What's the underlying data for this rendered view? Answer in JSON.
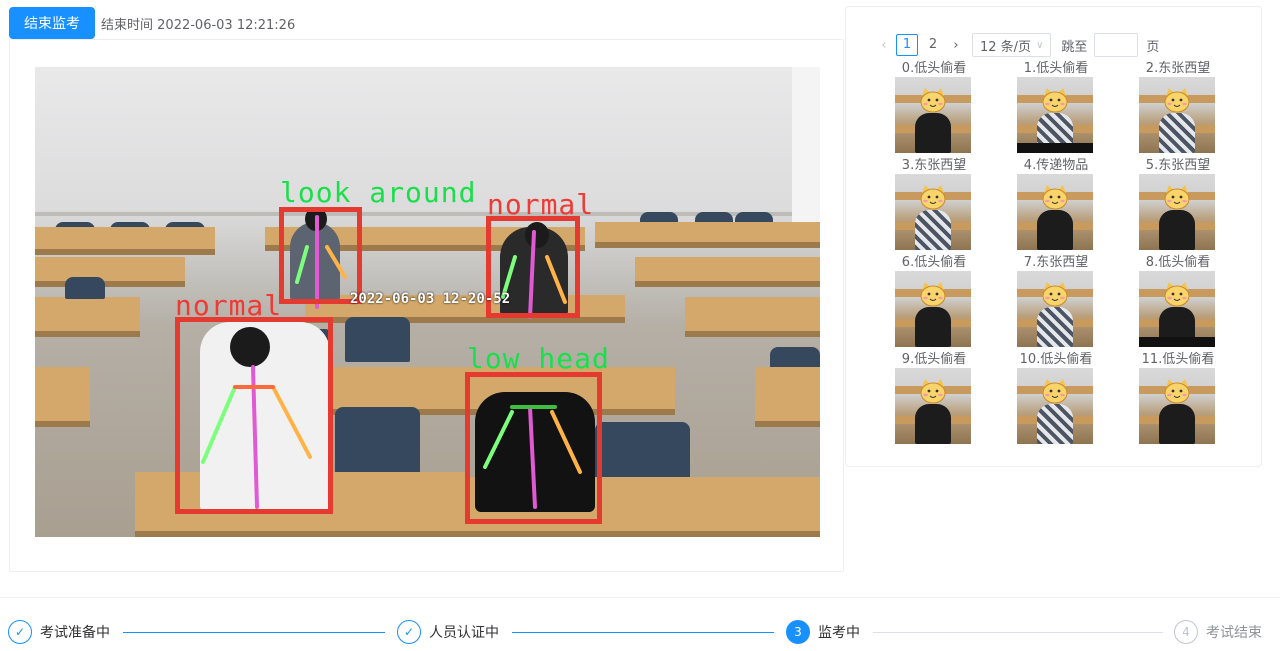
{
  "toolbar": {
    "end_button_label": "结束监考",
    "end_time_label": "结束时间",
    "end_time_value": "2022-06-03 12:21:26"
  },
  "video": {
    "timestamp": "2022-06-03 12-20-52",
    "detections": [
      {
        "label": "look around",
        "color": "green"
      },
      {
        "label": "normal",
        "color": "red"
      },
      {
        "label": "normal",
        "color": "red"
      },
      {
        "label": "low head",
        "color": "green"
      }
    ]
  },
  "pagination": {
    "prev_icon": "chevron-left-icon",
    "pages": [
      "1",
      "2"
    ],
    "current_page": "1",
    "next_icon": "chevron-right-icon",
    "page_size": "12 条/页",
    "jump_label": "跳至",
    "jump_value": "",
    "jump_suffix": "页"
  },
  "captures": [
    {
      "caption": "0.低头偷看"
    },
    {
      "caption": "1.低头偷看"
    },
    {
      "caption": "2.东张西望"
    },
    {
      "caption": "3.东张西望"
    },
    {
      "caption": "4.传递物品"
    },
    {
      "caption": "5.东张西望"
    },
    {
      "caption": "6.低头偷看"
    },
    {
      "caption": "7.东张西望"
    },
    {
      "caption": "8.低头偷看"
    },
    {
      "caption": "9.低头偷看"
    },
    {
      "caption": "10.低头偷看"
    },
    {
      "caption": "11.低头偷看"
    }
  ],
  "steps": [
    {
      "label": "考试准备中",
      "status": "done",
      "icon": "check-icon"
    },
    {
      "label": "人员认证中",
      "status": "done",
      "icon": "check-icon"
    },
    {
      "label": "监考中",
      "status": "process",
      "number": "3"
    },
    {
      "label": "考试结束",
      "status": "wait",
      "number": "4"
    }
  ],
  "colors": {
    "primary": "#1890ff",
    "bbox": "#e53a2f",
    "label_green": "#19e04a",
    "label_red": "#ef3b35"
  }
}
